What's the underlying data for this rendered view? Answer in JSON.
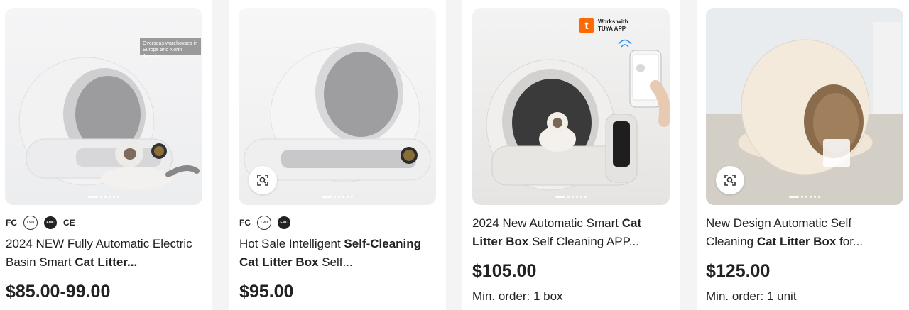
{
  "products": [
    {
      "certs": [
        "FC",
        "LVD",
        "EMC",
        "CE"
      ],
      "overseas_tag": "Overseas warehouses in Europe and North America",
      "title_parts": [
        "2024 NEW Fully Automatic Electric Basin Smart ",
        "Cat Litter",
        "..."
      ],
      "price": "$85.00-99.00",
      "image_dots": 6
    },
    {
      "certs": [
        "FC",
        "LVD",
        "EMC"
      ],
      "title_parts": [
        "Hot Sale Intelligent ",
        "Self-Cleaning Cat Litter Box",
        " Self..."
      ],
      "price": "$95.00",
      "image_dots": 6
    },
    {
      "badge": {
        "logo": "t",
        "line1": "Works with",
        "line2": "TUYA APP"
      },
      "title_parts": [
        "2024 New Automatic Smart ",
        "Cat Litter Box",
        " Self Cleaning APP..."
      ],
      "price": "$105.00",
      "moq": "Min. order: 1 box",
      "image_dots": 6
    },
    {
      "title_parts": [
        "New Design Automatic Self Cleaning ",
        "Cat Litter Box",
        " for..."
      ],
      "price": "$125.00",
      "moq": "Min. order: 1 unit",
      "image_dots": 6
    }
  ],
  "icons": {
    "image_search": "image-search-icon"
  },
  "colors": {
    "tuya_orange": "#ff6a00",
    "price_text": "#222222"
  }
}
